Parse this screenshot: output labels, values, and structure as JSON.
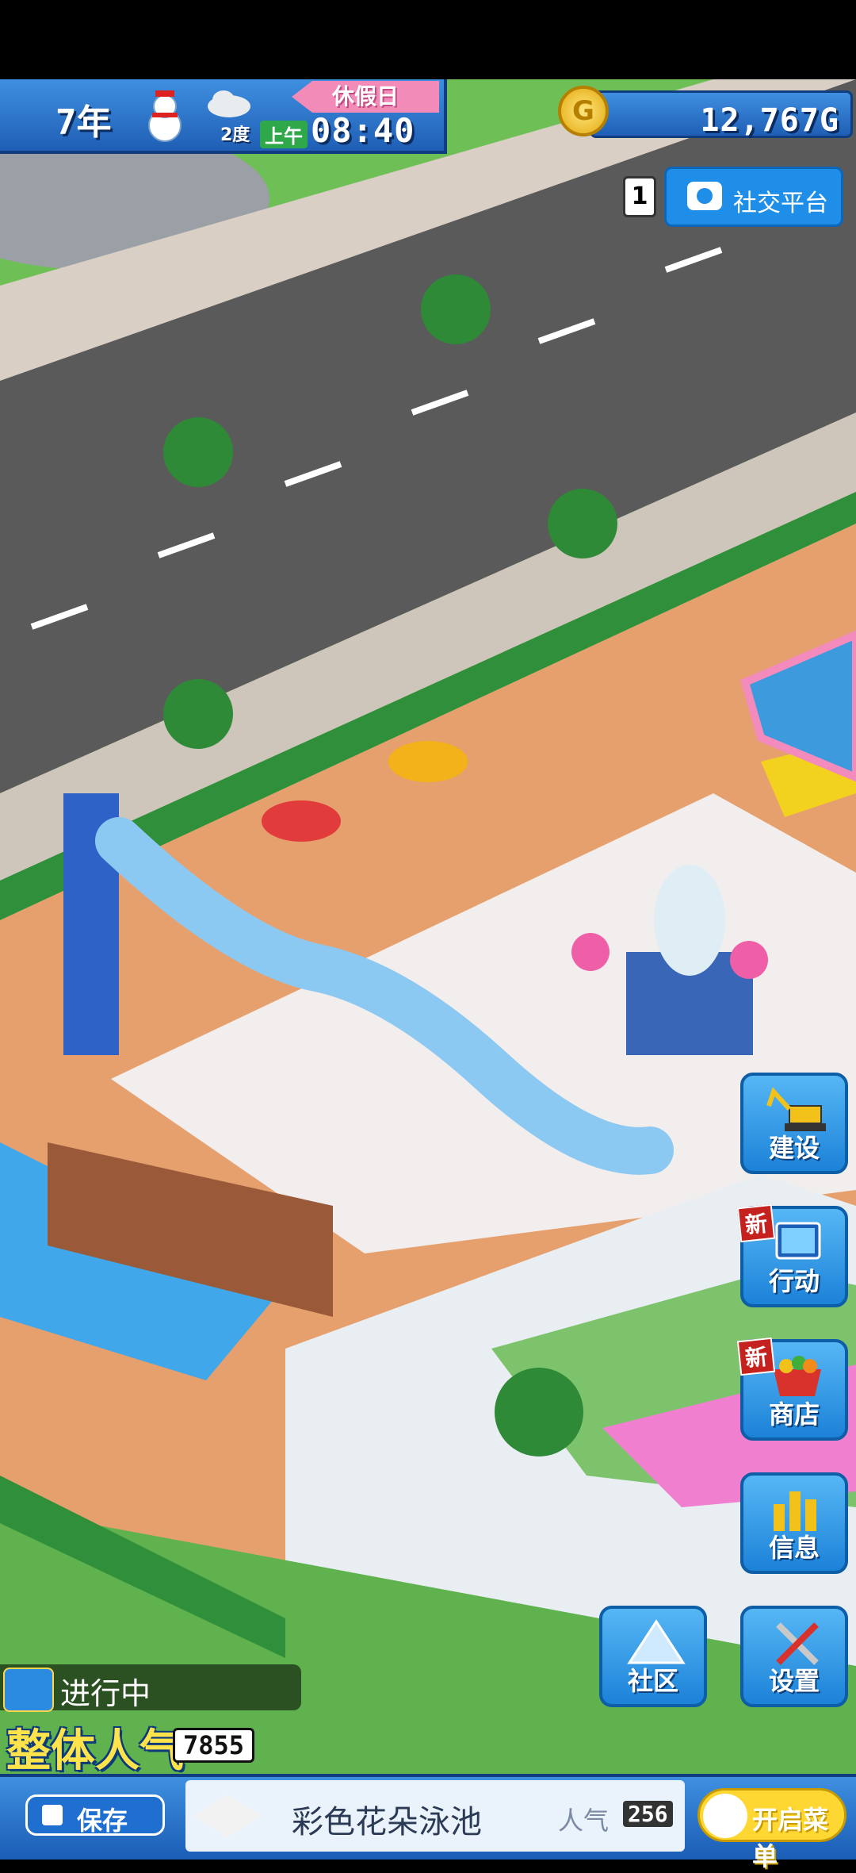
{
  "hud": {
    "year": "7年",
    "season_icon": "snowman-icon",
    "weather_icon": "cloud-icon",
    "temperature": "2度",
    "ampm": "上午",
    "time": "08:40",
    "day_type": "休假日"
  },
  "currency": {
    "icon": "gold-coin-icon",
    "symbol": "G",
    "value": "12,767G"
  },
  "social": {
    "count": "1",
    "label": "社交平台",
    "icon": "camera-icon"
  },
  "side_menu": [
    {
      "key": "build",
      "label": "建设",
      "icon": "excavator-icon",
      "badge": ""
    },
    {
      "key": "action",
      "label": "行动",
      "icon": "tablet-icon",
      "badge": "新"
    },
    {
      "key": "shop",
      "label": "商店",
      "icon": "shopping-basket-icon",
      "badge": "新"
    },
    {
      "key": "info",
      "label": "信息",
      "icon": "bar-chart-icon",
      "badge": ""
    }
  ],
  "bottom_tools": [
    {
      "key": "community",
      "label": "社区",
      "icon": "triangle-icon"
    },
    {
      "key": "settings",
      "label": "设置",
      "icon": "tools-icon"
    }
  ],
  "status": {
    "label": "进行中",
    "icon": "thumbs-up-icon"
  },
  "popularity": {
    "label": "整体人气",
    "value": "7855"
  },
  "save": {
    "label": "保存",
    "icon": "edit-icon"
  },
  "facility": {
    "name": "彩色花朵泳池",
    "pop_label": "人气",
    "pop_value": "256"
  },
  "menu_toggle": {
    "label": "开启菜单"
  },
  "colors": {
    "hud_blue": "#2b7cd6",
    "holiday_pink": "#f38bb8",
    "gold": "#e3a90c",
    "grass": "#4fb84a",
    "road": "#5a5a5a",
    "pool": "#3fa7ea"
  }
}
